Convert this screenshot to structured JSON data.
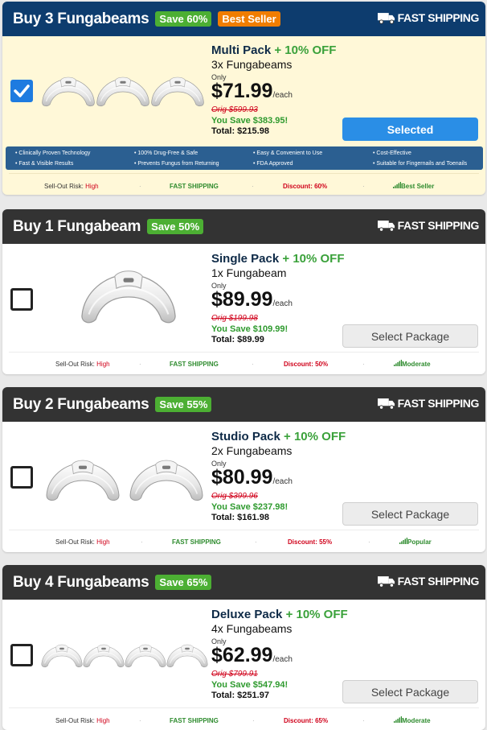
{
  "cards": [
    {
      "header_title": "Buy 3 Fungabeams",
      "save_badge": "Save 60%",
      "best_badge": "Best Seller",
      "fast_shipping": "FAST SHIPPING",
      "pack_name": "Multi Pack",
      "pack_off": "+ 10% OFF",
      "qty": "3x Fungabeams",
      "only": "Only",
      "price": "$71.99",
      "each": "/each",
      "orig": "Orig $599.93",
      "you_save": "You Save $383.95!",
      "total": "Total: $215.98",
      "button": "Selected",
      "checked": true,
      "features": [
        "Clinically Proven Technology",
        "100% Drug-Free & Safe",
        "Easy & Convenient to Use",
        "Cost-Effective",
        "Fast & Visible Results",
        "Prevents Fungus from Returning",
        "FDA Approved",
        "Suitable for Fingernails and Toenails"
      ],
      "footer": {
        "risk_label": "Sell-Out Risk:",
        "risk_value": "High",
        "shipping": "FAST SHIPPING",
        "discount": "Discount: 60%",
        "popularity": "Best Seller"
      }
    },
    {
      "header_title": "Buy 1 Fungabeam",
      "save_badge": "Save 50%",
      "fast_shipping": "FAST SHIPPING",
      "pack_name": "Single Pack",
      "pack_off": "+ 10% OFF",
      "qty": "1x Fungabeam",
      "only": "Only",
      "price": "$89.99",
      "each": "/each",
      "orig": "Orig $199.98",
      "you_save": "You Save $109.99!",
      "total": "Total: $89.99",
      "button": "Select Package",
      "checked": false,
      "footer": {
        "risk_label": "Sell-Out Risk:",
        "risk_value": "High",
        "shipping": "FAST SHIPPING",
        "discount": "Discount: 50%",
        "popularity": "Moderate"
      }
    },
    {
      "header_title": "Buy 2 Fungabeams",
      "save_badge": "Save 55%",
      "fast_shipping": "FAST SHIPPING",
      "pack_name": "Studio Pack",
      "pack_off": "+ 10% OFF",
      "qty": "2x Fungabeams",
      "only": "Only",
      "price": "$80.99",
      "each": "/each",
      "orig": "Orig $399.96",
      "you_save": "You Save $237.98!",
      "total": "Total: $161.98",
      "button": "Select Package",
      "checked": false,
      "footer": {
        "risk_label": "Sell-Out Risk:",
        "risk_value": "High",
        "shipping": "FAST SHIPPING",
        "discount": "Discount: 55%",
        "popularity": "Popular"
      }
    },
    {
      "header_title": "Buy 4 Fungabeams",
      "save_badge": "Save 65%",
      "fast_shipping": "FAST SHIPPING",
      "pack_name": "Deluxe Pack",
      "pack_off": "+ 10% OFF",
      "qty": "4x Fungabeams",
      "only": "Only",
      "price": "$62.99",
      "each": "/each",
      "orig": "Orig $799.91",
      "you_save": "You Save $547.94!",
      "total": "Total: $251.97",
      "button": "Select Package",
      "checked": false,
      "footer": {
        "risk_label": "Sell-Out Risk:",
        "risk_value": "High",
        "shipping": "FAST SHIPPING",
        "discount": "Discount: 65%",
        "popularity": "Moderate"
      }
    }
  ],
  "colors": {
    "selected_header": "#0d3c6e",
    "header": "#333333",
    "save_badge": "#4caf33",
    "best_badge": "#f07d00",
    "selected_button": "#2a8ee6",
    "price_green": "#2e9a2e",
    "risk_red": "#d0021b"
  },
  "icons": [
    "truck-icon",
    "checkmark-icon",
    "signal-bars-icon",
    "fungabeam-device-image"
  ]
}
